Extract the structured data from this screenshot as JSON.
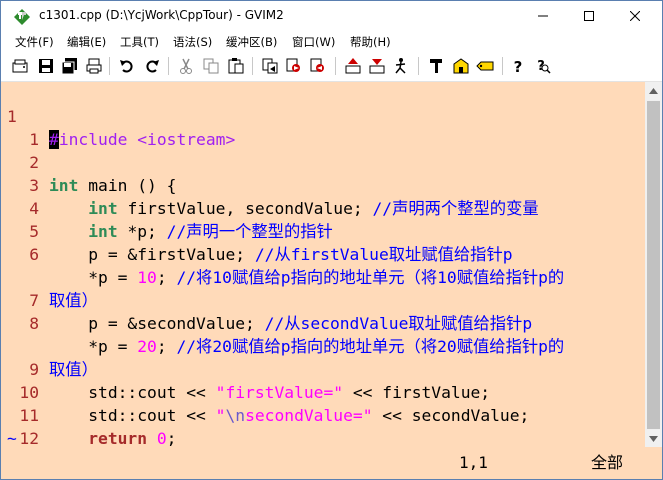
{
  "window": {
    "title": "c1301.cpp (D:\\YcjWork\\CppTour) - GVIM2",
    "app_icon": "vim-icon"
  },
  "menu": [
    {
      "label": "文件(F)"
    },
    {
      "label": "编辑(E)"
    },
    {
      "label": "工具(T)"
    },
    {
      "label": "语法(S)"
    },
    {
      "label": "缓冲区(B)"
    },
    {
      "label": "窗口(W)"
    },
    {
      "label": "帮助(H)"
    }
  ],
  "toolbar": [
    {
      "icon": "open-icon"
    },
    {
      "icon": "save-icon"
    },
    {
      "icon": "save-all-icon"
    },
    {
      "icon": "print-icon"
    },
    {
      "icon": "undo-icon"
    },
    {
      "icon": "redo-icon"
    },
    {
      "icon": "cut-icon"
    },
    {
      "icon": "copy-icon"
    },
    {
      "icon": "paste-icon"
    },
    {
      "icon": "replace-icon"
    },
    {
      "icon": "find-next-icon"
    },
    {
      "icon": "find-prev-icon"
    },
    {
      "icon": "load-session-icon"
    },
    {
      "icon": "save-session-icon"
    },
    {
      "icon": "run-script-icon"
    },
    {
      "icon": "make-icon"
    },
    {
      "icon": "shell-icon"
    },
    {
      "icon": "tag-jump-icon"
    },
    {
      "icon": "help-icon"
    },
    {
      "icon": "find-help-icon"
    }
  ],
  "editor": {
    "lines": [
      {
        "num": "1",
        "text": "#include <iostream>"
      },
      {
        "num": "1",
        "text": ""
      },
      {
        "num": "2",
        "text": "int main () {"
      },
      {
        "num": "3",
        "text": "    int firstValue, secondValue; //声明两个整型的变量"
      },
      {
        "num": "4",
        "text": "    int *p; //声明一个整型的指针"
      },
      {
        "num": "5",
        "text": "    p = &firstValue; //从firstValue取址赋值给指针p"
      },
      {
        "num": "6",
        "text": "    *p = 10; //将10赋值给p指向的地址单元（将10赋值给指针p的"
      },
      {
        "num": "",
        "text": "取值）"
      },
      {
        "num": "7",
        "text": "    p = &secondValue; //从secondValue取址赋值给指针p"
      },
      {
        "num": "8",
        "text": "    *p = 20; //将20赋值给p指向的地址单元（将20赋值给指针p的"
      },
      {
        "num": "",
        "text": "取值）"
      },
      {
        "num": "9",
        "text": "    std::cout << \"firstValue=\" << firstValue;"
      },
      {
        "num": "10",
        "text": "    std::cout << \"\\nsecondValue=\" << secondValue;"
      },
      {
        "num": "11",
        "text": "    return 0;"
      },
      {
        "num": "12",
        "text": "}"
      }
    ],
    "tilde": "~"
  },
  "status": {
    "ruler": "1,1",
    "position": "全部"
  },
  "colors": {
    "editor_bg": "#ffdab9",
    "line_number": "#a52a2a",
    "preproc": "#a020f0",
    "type": "#2e8b57",
    "keyword": "#a52a2a",
    "number": "#ff00ff",
    "comment": "#0000ff",
    "string": "#ff00ff"
  }
}
